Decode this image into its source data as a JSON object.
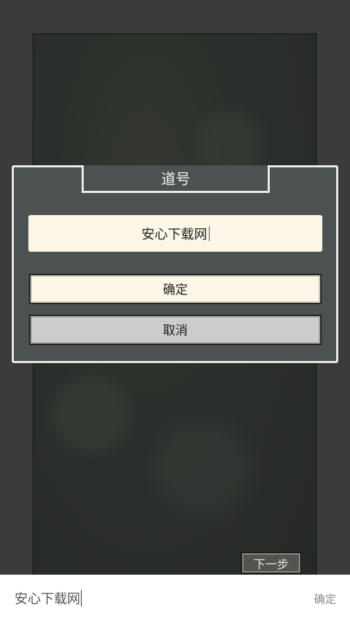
{
  "dialog": {
    "title": "道号",
    "input_value": "安心下载网",
    "confirm_label": "确定",
    "cancel_label": "取消"
  },
  "background": {
    "next_label": "下一步"
  },
  "ime_bar": {
    "text": "安心下载网",
    "confirm_label": "确定"
  }
}
